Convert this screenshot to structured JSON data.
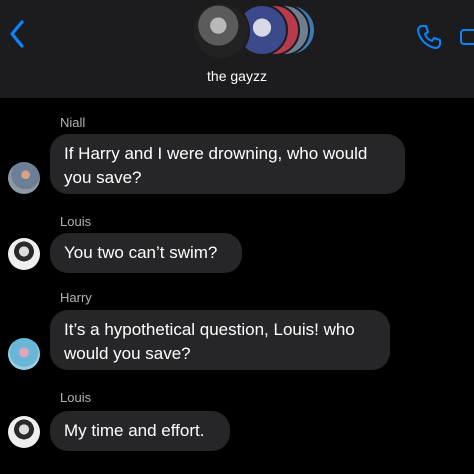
{
  "header": {
    "group_name": "the gayzz",
    "back_icon": "chevron-left-icon",
    "call_icon": "phone-icon",
    "video_icon": "video-camera-icon",
    "accent_color": "#0a84ff"
  },
  "messages": [
    {
      "sender": "Niall",
      "text": "If Harry and I were drowning, who would you save?"
    },
    {
      "sender": "Louis",
      "text": "You two can’t swim?"
    },
    {
      "sender": "Harry",
      "text": "It’s a hypothetical question, Louis! who would you save?"
    },
    {
      "sender": "Louis",
      "text": "My time and effort."
    }
  ]
}
